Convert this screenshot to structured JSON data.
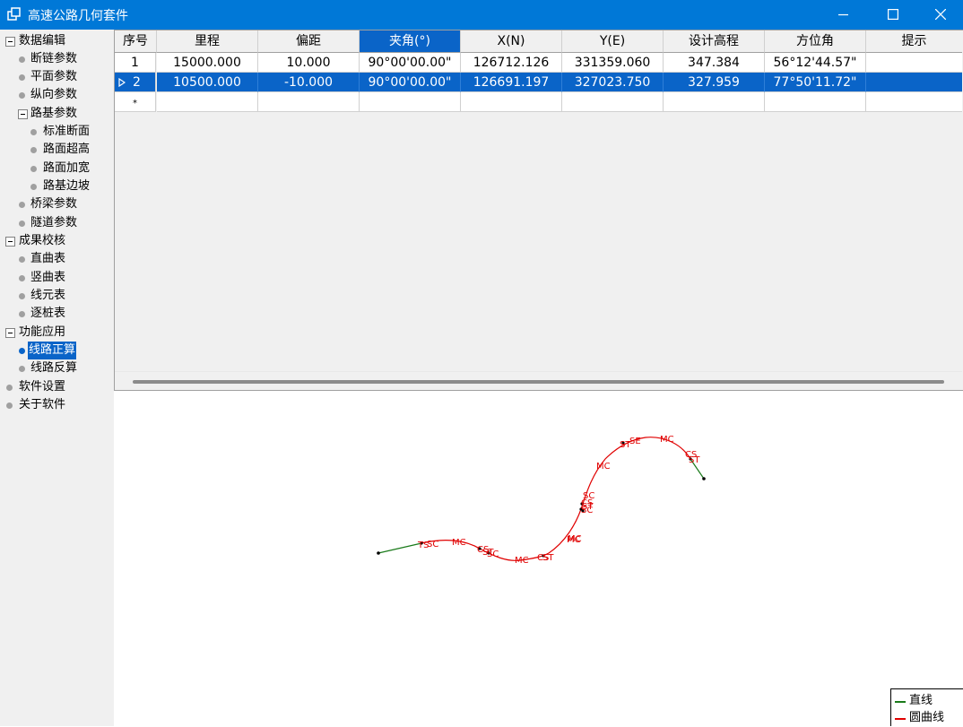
{
  "window": {
    "title": "高速公路几何套件",
    "accent_color": "#0078d7",
    "icons": {
      "app": "window-stack-icon",
      "minimize": "minimize-icon",
      "maximize": "maximize-icon",
      "close": "close-icon"
    }
  },
  "sidebar": {
    "selection_color": "#0a64c8",
    "groups": [
      {
        "label": "数据编辑",
        "expanded": true
      },
      {
        "label": "成果校核",
        "expanded": true
      },
      {
        "label": "功能应用",
        "expanded": true
      },
      {
        "label": "软件设置"
      },
      {
        "label": "关于软件"
      }
    ],
    "items": {
      "duanlian": "断链参数",
      "pingmian": "平面参数",
      "zongxiang": "纵向参数",
      "luji": "路基参数",
      "biaozhun": "标准断面",
      "chaogao": "路面超高",
      "jiakuan": "路面加宽",
      "bianpo": "路基边坡",
      "qiaoliang": "桥梁参数",
      "suidao": "隧道参数",
      "zhiqu": "直曲表",
      "shuqu": "竖曲表",
      "xianyuan": "线元表",
      "zhuzhuang": "逐桩表",
      "zhengsuan": "线路正算",
      "fansuan": "线路反算"
    },
    "selected_item": "线路正算"
  },
  "table": {
    "columns": [
      "序号",
      "里程",
      "偏距",
      "夹角(°)",
      "X(N)",
      "Y(E)",
      "设计高程",
      "方位角",
      "提示"
    ],
    "active_column": "夹角(°)",
    "rows": [
      {
        "index": "1",
        "mileage": "15000.000",
        "offset": "10.000",
        "angle": "90°00'00.00\"",
        "x": "126712.126",
        "y": "331359.060",
        "elevation": "347.384",
        "azimuth": "56°12'44.57\"",
        "hint": ""
      },
      {
        "index": "2",
        "mileage": "10500.000",
        "offset": "-10.000",
        "angle": "90°00'00.00\"",
        "x": "126691.197",
        "y": "327023.750",
        "elevation": "327.959",
        "azimuth": "77°50'11.72\"",
        "hint": ""
      }
    ],
    "selected_row": 2,
    "new_row_marker": "*",
    "current_row_icon": "row-pointer-icon"
  },
  "drawing": {
    "straight_color": "#1a7a1a",
    "curve_color": "#e00000",
    "point_labels": [
      "TS",
      "SC",
      "MC",
      "CS",
      "ST",
      "SC",
      "MC",
      "CS",
      "ST",
      "SC",
      "MC",
      "CS",
      "ST",
      "SC",
      "CS",
      "ST",
      "SC",
      "MC",
      "CS",
      "ST",
      "TS",
      "SC",
      "MC",
      "CS",
      "ST"
    ],
    "legend": [
      {
        "label": "直线",
        "color": "#1a7a1a"
      },
      {
        "label": "圆曲线",
        "color": "#e00000"
      }
    ]
  }
}
